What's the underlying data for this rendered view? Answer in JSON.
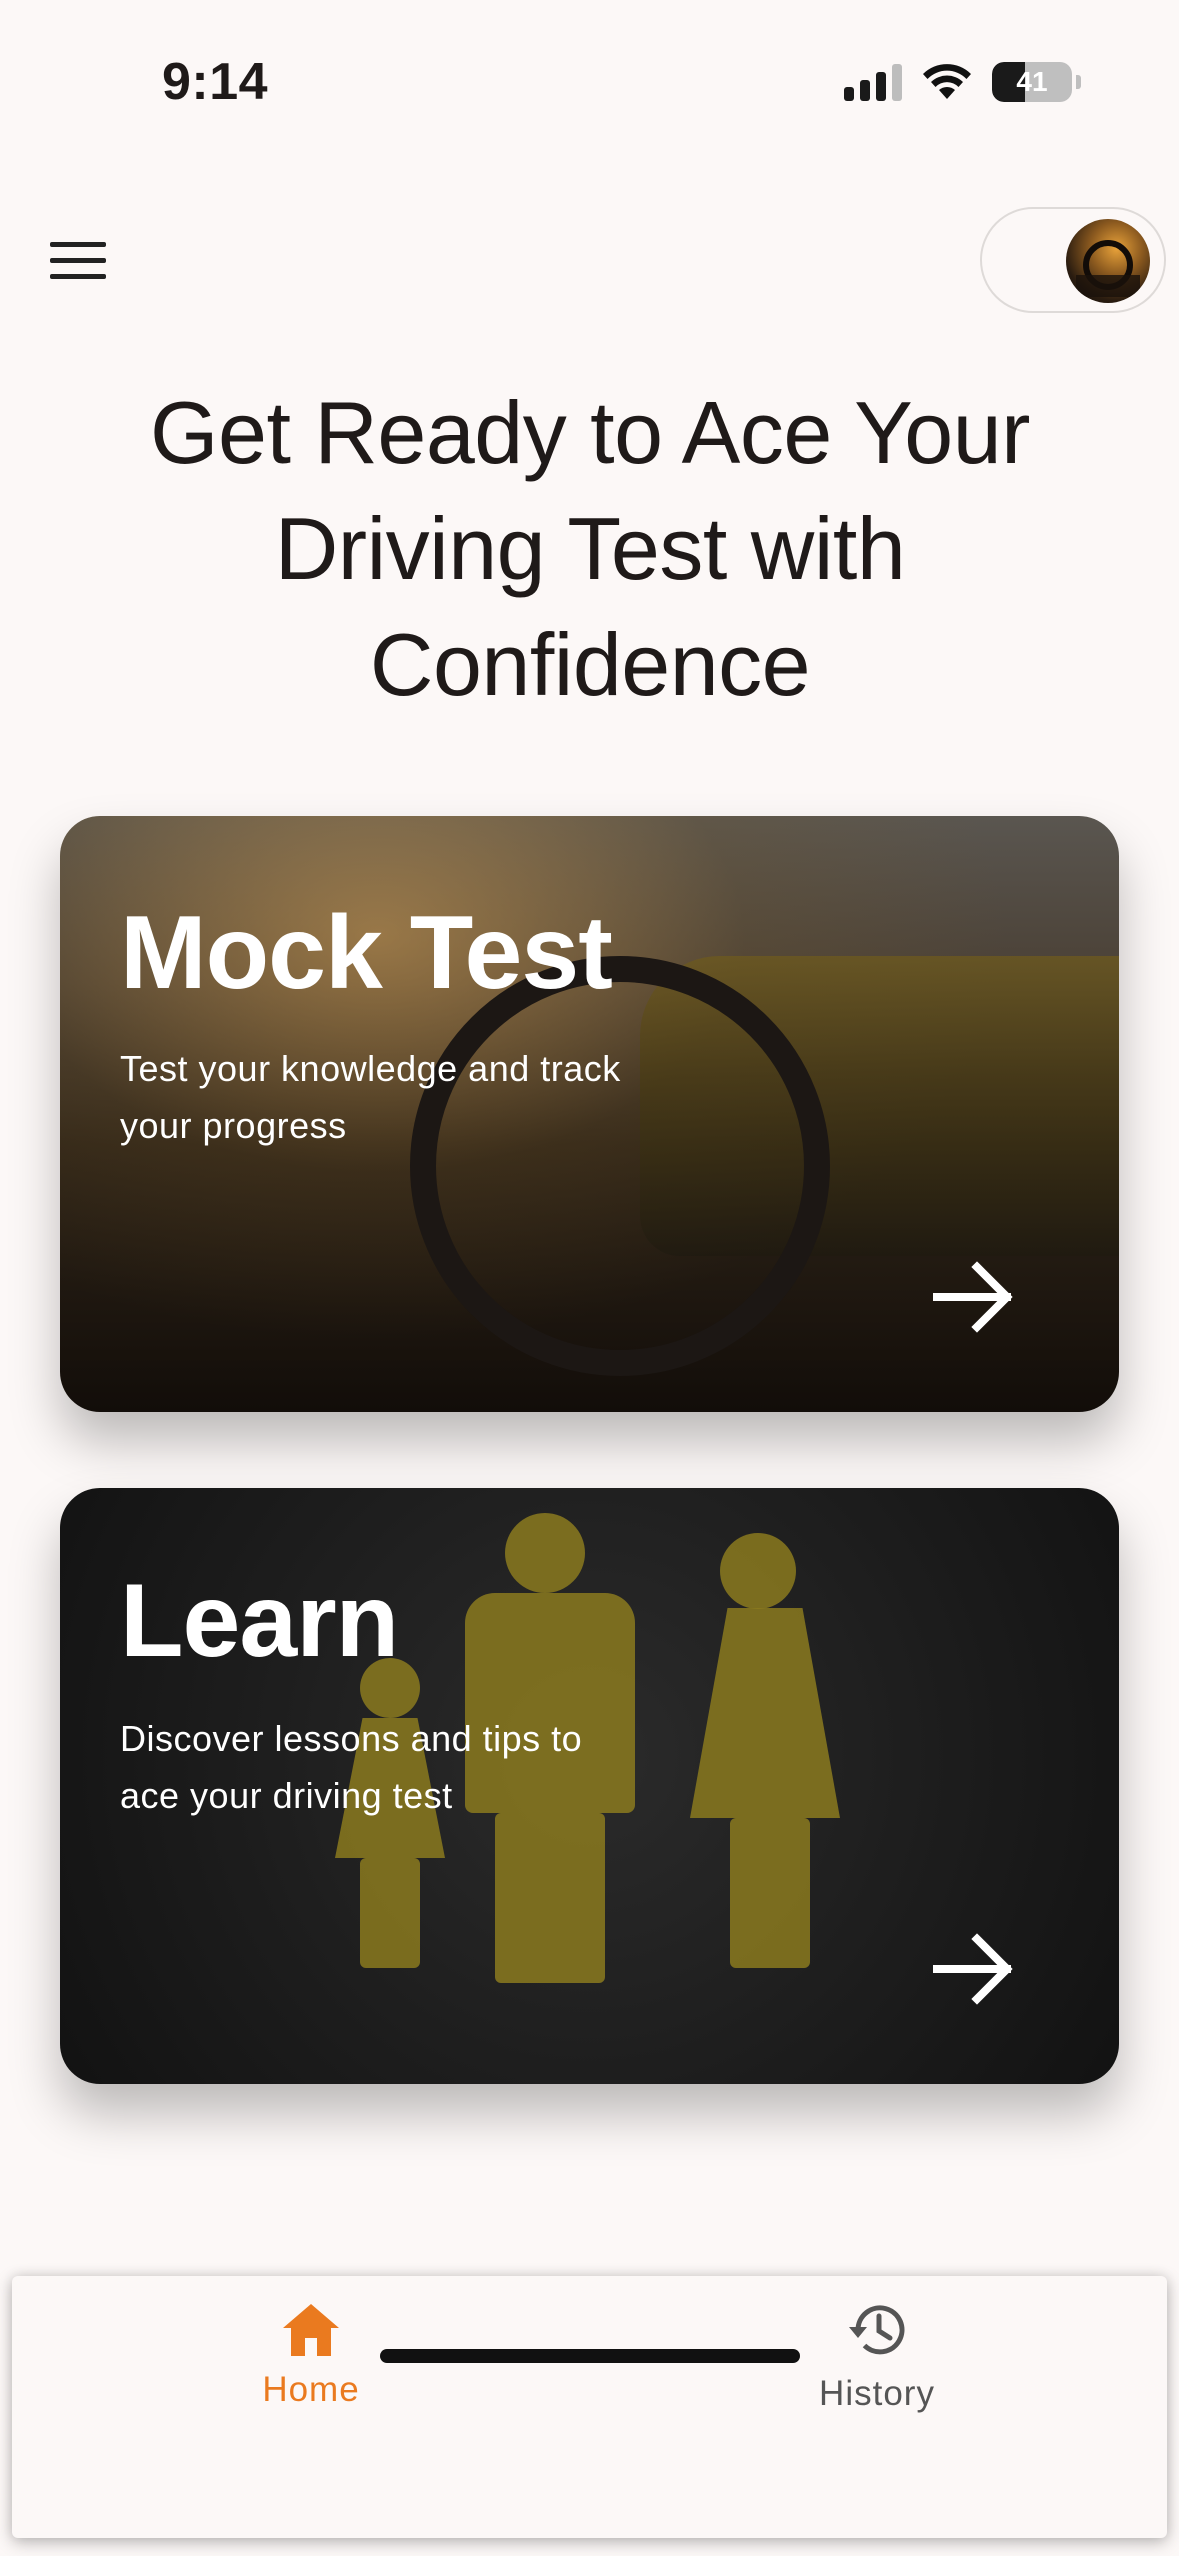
{
  "status_bar": {
    "time": "9:14",
    "battery": "41",
    "battery_level_percent": 41,
    "icons": [
      "signal-icon",
      "wifi-icon",
      "battery-icon"
    ]
  },
  "header": {
    "menu_icon": "hamburger-menu-icon",
    "avatar": "profile-avatar"
  },
  "hero": {
    "headline": "Get Ready to Ace Your Driving Test with Confidence"
  },
  "cards": [
    {
      "title": "Mock Test",
      "subtitle": "Test your knowledge and track your progress",
      "action_icon": "arrow-right-icon"
    },
    {
      "title": "Learn",
      "subtitle": "Discover lessons and tips to ace your driving test",
      "action_icon": "arrow-right-icon"
    }
  ],
  "bottom_nav": {
    "items": [
      {
        "label": "Home",
        "icon": "home-icon",
        "active": true
      },
      {
        "label": "History",
        "icon": "history-icon",
        "active": false
      }
    ]
  },
  "colors": {
    "background": "#fcf8f7",
    "accent": "#ea7a1f",
    "text": "#1f1a19",
    "inactive": "#555555"
  }
}
